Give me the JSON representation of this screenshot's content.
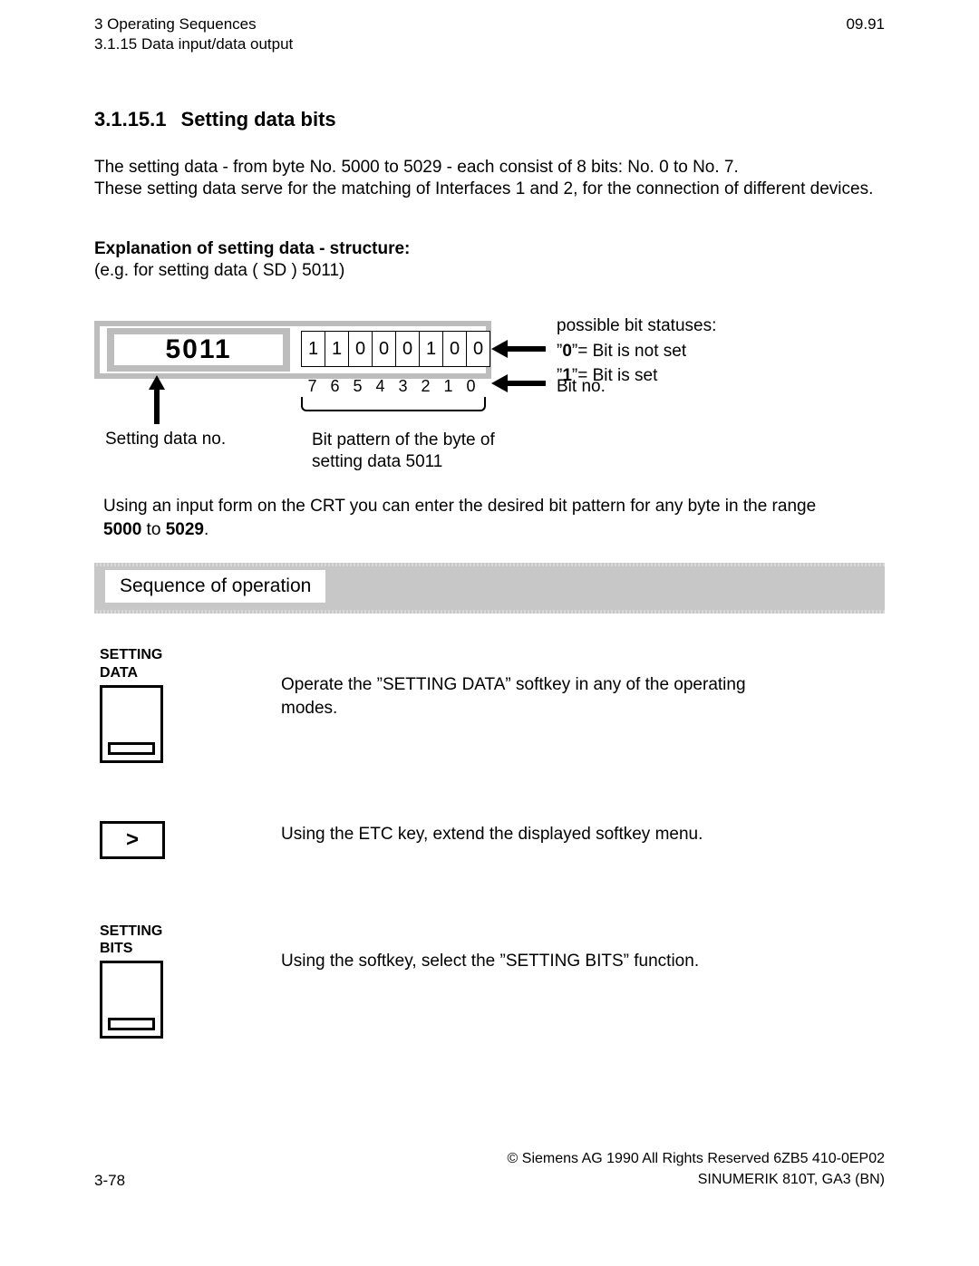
{
  "header": {
    "chapter": "3  Operating Sequences",
    "section": "3.1.15  Data input/data output",
    "date": "09.91"
  },
  "title": {
    "number": "3.1.15.1",
    "text": "Setting data bits"
  },
  "intro": {
    "p1": "The setting data - from byte No. 5000 to 5029 - each consist of 8 bits: No. 0 to No. 7.",
    "p2": "These setting data serve for the matching of Interfaces 1 and 2, for the connection of different devices."
  },
  "explain": {
    "head": "Explanation of setting data - structure:",
    "eg": "(e.g. for setting data ( SD ) 5011)"
  },
  "diagram": {
    "sd_no": "5011",
    "bits": [
      "1",
      "1",
      "0",
      "0",
      "0",
      "1",
      "0",
      "0"
    ],
    "bit_nos": [
      "7",
      "6",
      "5",
      "4",
      "3",
      "2",
      "1",
      "0"
    ],
    "status_head": "possible bit statuses:",
    "status_0a": "”",
    "status_0b": "0",
    "status_0c": "”= Bit is not set",
    "status_1a": "”",
    "status_1b": "1",
    "status_1c": "”= Bit is set",
    "bitno_label": "Bit no.",
    "sdno_label": "Setting data no.",
    "bitpat_label_l1": "Bit pattern of the byte of",
    "bitpat_label_l2": "setting data 5011"
  },
  "crt": {
    "pre": "Using an input form on the CRT you can enter the desired bit pattern for any byte in the range ",
    "b1": "5000",
    "mid": " to ",
    "b2": "5029",
    "post": "."
  },
  "seq": {
    "label": "Sequence of operation"
  },
  "steps": {
    "s1": {
      "label_l1": "SETTING",
      "label_l2": "DATA",
      "text": "Operate the ”SETTING DATA” softkey in any of the operating modes."
    },
    "s2": {
      "glyph": ">",
      "text": "Using the ETC key, extend the displayed softkey menu."
    },
    "s3": {
      "label_l1": "SETTING",
      "label_l2": "BITS",
      "text": "Using the softkey, select the ”SETTING BITS” function."
    }
  },
  "footer": {
    "page": "3-78",
    "copyright": "© Siemens AG 1990 All Rights Reserved     6ZB5 410-0EP02",
    "product": "SINUMERIK 810T, GA3 (BN)"
  }
}
